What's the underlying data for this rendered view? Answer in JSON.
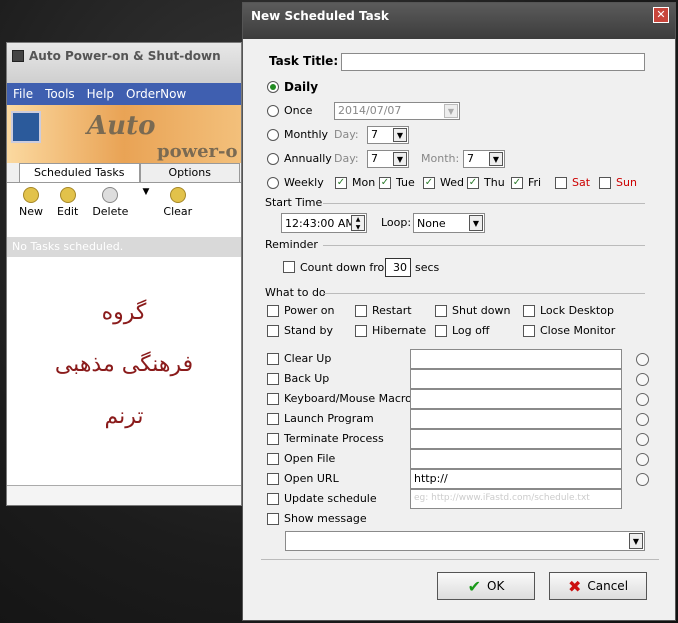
{
  "bg_window": {
    "title": "Auto Power-on & Shut-down",
    "menu": [
      "File",
      "Tools",
      "Help",
      "OrderNow"
    ],
    "banner_text": "Auto",
    "banner_text2": "power-o",
    "tabs": [
      "Scheduled Tasks",
      "Options"
    ],
    "toolbar": [
      "New",
      "Edit",
      "Delete",
      "Clear"
    ],
    "empty_text": "No Tasks scheduled.",
    "calligraphy": [
      "گروه",
      "فرهنگی مذهبی",
      "ترنم"
    ]
  },
  "dialog": {
    "title": "New Scheduled Task",
    "task_title_label": "Task Title:",
    "task_title_value": "",
    "schedule": {
      "daily": "Daily",
      "once": "Once",
      "once_date": "2014/07/07",
      "monthly": "Monthly",
      "annually": "Annually",
      "weekly": "Weekly",
      "day_label": "Day:",
      "month_label": "Month:",
      "monthly_day": "7",
      "annual_day": "7",
      "annual_month": "7",
      "weekdays": [
        "Mon",
        "Tue",
        "Wed",
        "Thu",
        "Fri",
        "Sat",
        "Sun"
      ]
    },
    "start_time_label": "Start Time",
    "start_time_value": "12:43:00 AM",
    "loop_label": "Loop:",
    "loop_value": "None",
    "reminder_label": "Reminder",
    "countdown_label": "Count down from",
    "countdown_value": "30",
    "countdown_unit": "secs",
    "what_label": "What to do",
    "actions": [
      "Power on",
      "Restart",
      "Shut down",
      "Lock Desktop",
      "Stand by",
      "Hibernate",
      "Log off",
      "Close Monitor"
    ],
    "tasks": [
      "Clear Up",
      "Back Up",
      "Keyboard/Mouse Macro",
      "Launch Program",
      "Terminate Process",
      "Open File",
      "Open URL",
      "Update schedule",
      "Show message"
    ],
    "url_value": "http://",
    "update_placeholder": "eg: http://www.iFastd.com/schedule.txt",
    "ok_label": "OK",
    "cancel_label": "Cancel"
  }
}
